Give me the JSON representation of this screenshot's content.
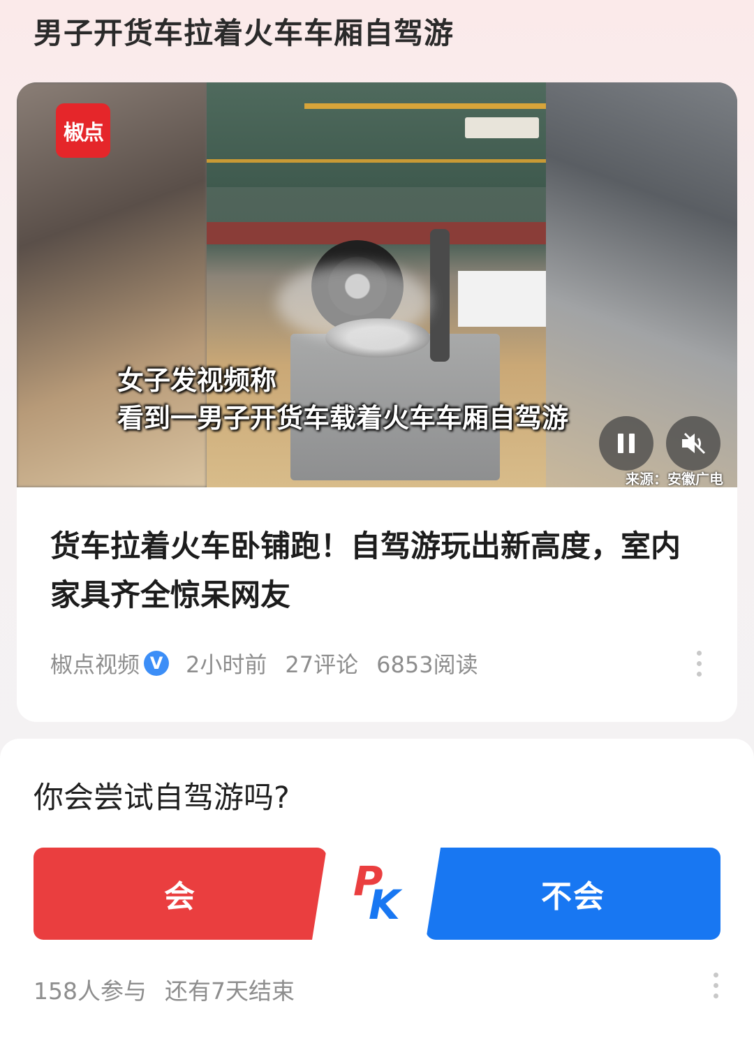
{
  "topic": {
    "title": "男子开货车拉着火车车厢自驾游"
  },
  "video": {
    "logo_text": "椒点",
    "caption_line1": "女子发视频称",
    "caption_line2": "看到一男子开货车载着火车车厢自驾游",
    "source": "来源：安徽广电",
    "controls": {
      "pause_icon": "pause-icon",
      "mute_icon": "mute-icon"
    }
  },
  "article": {
    "headline": "货车拉着火车卧铺跑！自驾游玩出新高度，室内家具齐全惊呆网友",
    "publisher": "椒点视频",
    "verified_badge": "V",
    "time": "2小时前",
    "comments": "27评论",
    "reads": "6853阅读"
  },
  "poll": {
    "question": "你会尝试自驾游吗?",
    "option_yes": "会",
    "option_no": "不会",
    "pk_p": "P",
    "pk_k": "K",
    "participants": "158人参与",
    "remaining": "还有7天结束"
  },
  "colors": {
    "yes": "#ea3e3f",
    "no": "#1877f2",
    "badge": "#3c8ef7",
    "logo": "#e5262a"
  }
}
